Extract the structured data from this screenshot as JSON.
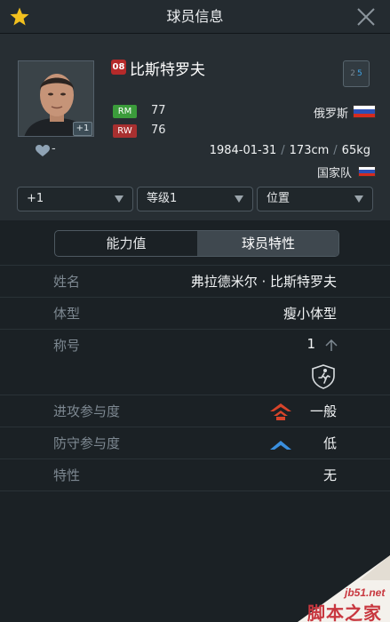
{
  "header": {
    "title": "球员信息",
    "star_color": "#f2c01e"
  },
  "player": {
    "number": "08",
    "name": "比斯特罗夫",
    "avatar_plus": "+1",
    "likes": "-",
    "positions": [
      {
        "code": "RM",
        "rating": "77",
        "color": "#3b9c3b"
      },
      {
        "code": "RW",
        "rating": "76",
        "color": "#a83030"
      }
    ],
    "boots": {
      "left": "2",
      "right": "5"
    },
    "country": "俄罗斯",
    "birth": "1984-01-31",
    "height": "173cm",
    "weight": "65kg",
    "national_team": "国家队"
  },
  "filters": {
    "level_plus": "+1",
    "grade": "等级1",
    "position": "位置"
  },
  "tabs": [
    {
      "label": "能力值",
      "active": false
    },
    {
      "label": "球员特性",
      "active": true
    }
  ],
  "attributes": {
    "name_label": "姓名",
    "name_value": "弗拉德米尔 · 比斯特罗夫",
    "body_label": "体型",
    "body_value": "瘦小体型",
    "title_label": "称号",
    "title_value": "1",
    "attack_label": "进攻参与度",
    "attack_value": "一般",
    "defense_label": "防守参与度",
    "defense_value": "低",
    "trait_label": "特性",
    "trait_value": "无"
  },
  "watermark": {
    "site": "jb51.net",
    "name": "脚本之家"
  }
}
